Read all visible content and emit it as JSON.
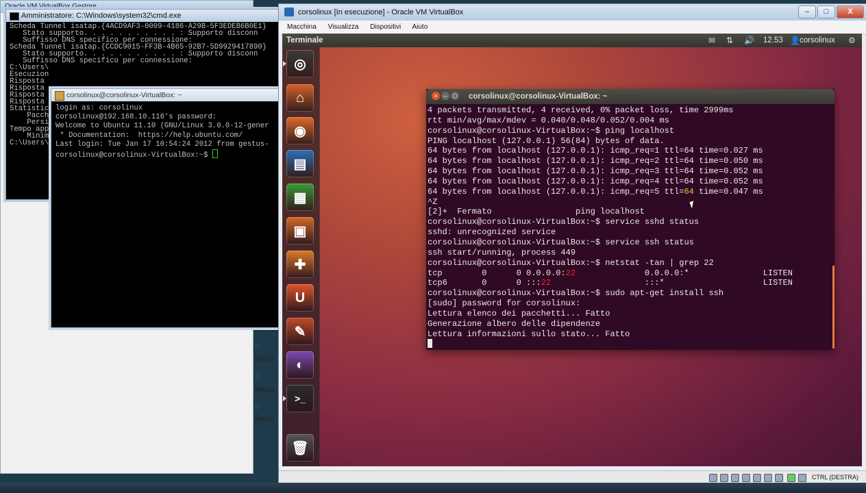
{
  "vbox_manager": {
    "title": "Oracle VM VirtualBox Gestore",
    "items": [
      "Scheda",
      "U",
      "Filtri d",
      "C",
      "Nessu",
      "D",
      "Nessu"
    ]
  },
  "cmd": {
    "title": "Amministratore: C:\\Windows\\system32\\cmd.exe",
    "lines": [
      "Scheda Tunnel isatap.{4ACD9AF3-0009-4186-A29B-5F3EDEB6B0E1}",
      "",
      "   Stato supporto. . . . . . . . . . . : Supporto disconn",
      "   Suffisso DNS specifico per connessione:",
      "",
      "Scheda Tunnel isatap.{CCDC9015-FF3B-4B65-92B7-5D9929417890}",
      "",
      "   Stato supporto. . . . . . . . . . . : Supporto disconn",
      "   Suffisso DNS specifico per connessione:",
      "",
      "C:\\Users\\",
      "",
      "Esecuzion",
      "Risposta",
      "Risposta",
      "Risposta",
      "Risposta",
      "",
      "Statistic",
      "    Pacch",
      "    Persi",
      "Tempo app",
      "    Minim",
      "",
      "C:\\Users\\"
    ]
  },
  "putty": {
    "title": "corsolinux@corsolinux-VirtualBox: ~",
    "lines": [
      "login as: corsolinux",
      "corsolinux@192.168.10.116's password:",
      "Welcome to Ubuntu 11.10 (GNU/Linux 3.0.0-12-gener",
      "",
      " * Documentation:  https://help.ubuntu.com/",
      "",
      "Last login: Tue Jan 17 10:54:24 2012 from gestus-"
    ],
    "prompt": "corsolinux@corsolinux-VirtualBox:~$ "
  },
  "vbox": {
    "title": "corsolinux [In esecuzione] - Oracle VM VirtualBox",
    "menu": [
      "Macchina",
      "Visualizza",
      "Dispositivi",
      "Aiuto"
    ],
    "host_key": "CTRL (DESTRA)",
    "buttons": {
      "minimize": "–",
      "maximize": "□",
      "close": "X"
    }
  },
  "ubuntu": {
    "app_name": "Terminale",
    "clock": "12.53",
    "user": "corsolinux",
    "launcher": [
      {
        "name": "dash-icon",
        "color": "#3a3a3a",
        "glyph": "◎"
      },
      {
        "name": "home-folder-icon",
        "color": "#d8622b",
        "glyph": "⌂"
      },
      {
        "name": "firefox-icon",
        "color": "#e0692a",
        "glyph": "◉"
      },
      {
        "name": "writer-icon",
        "color": "#2e6fb8",
        "glyph": "▤"
      },
      {
        "name": "calc-icon",
        "color": "#3a9a3a",
        "glyph": "▦"
      },
      {
        "name": "impress-icon",
        "color": "#d46a2a",
        "glyph": "▣"
      },
      {
        "name": "software-center-icon",
        "color": "#e07a2a",
        "glyph": "✚"
      },
      {
        "name": "ubuntu-one-icon",
        "color": "#e0552a",
        "glyph": "U"
      },
      {
        "name": "settings-icon",
        "color": "#c24a2a",
        "glyph": "✎"
      },
      {
        "name": "workspaces-icon",
        "color": "#7a4ab0",
        "glyph": "◐"
      },
      {
        "name": "terminal-icon",
        "color": "#2b2b2b",
        "glyph": ">_"
      },
      {
        "name": "trash-icon",
        "color": "#555555",
        "glyph": "🗑"
      }
    ]
  },
  "terminal": {
    "title": "corsolinux@corsolinux-VirtualBox: ~",
    "lines": [
      "4 packets transmitted, 4 received, 0% packet loss, time 2999ms",
      "rtt min/avg/max/mdev = 0.040/0.048/0.052/0.004 ms",
      "corsolinux@corsolinux-VirtualBox:~$ ping localhost",
      "PING localhost (127.0.0.1) 56(84) bytes of data.",
      "64 bytes from localhost (127.0.0.1): icmp_req=1 ttl=64 time=0.027 ms",
      "64 bytes from localhost (127.0.0.1): icmp_req=2 ttl=64 time=0.050 ms",
      "64 bytes from localhost (127.0.0.1): icmp_req=3 ttl=64 time=0.052 ms",
      "64 bytes from localhost (127.0.0.1): icmp_req=4 ttl=64 time=0.052 ms",
      "64 bytes from localhost (127.0.0.1): icmp_req=5 ttl=64 time=0.047 ms",
      "^Z",
      "[2]+  Fermato                 ping localhost",
      "corsolinux@corsolinux-VirtualBox:~$ service sshd status",
      "sshd: unrecognized service",
      "corsolinux@corsolinux-VirtualBox:~$ service ssh status",
      "ssh start/running, process 449",
      "corsolinux@corsolinux-VirtualBox:~$ netstat -tan | grep 22",
      {
        "pre": "tcp        0      0 0.0.0.0:",
        "hl": "22",
        "post": "              0.0.0.0:*               LISTEN"
      },
      {
        "pre": "tcp6       0      0 :::",
        "hl": "22",
        "post": "                   :::*                    LISTEN"
      },
      "corsolinux@corsolinux-VirtualBox:~$ sudo apt-get install ssh",
      "[sudo] password for corsolinux:",
      "Lettura elenco dei pacchetti... Fatto",
      "Generazione albero delle dipendenze",
      "Lettura informazioni sullo stato... Fatto"
    ]
  },
  "colors": {
    "terminal_bg": "#300a24",
    "grep_highlight": "#ef2929",
    "ubuntu_accent": "#e07a3a"
  }
}
